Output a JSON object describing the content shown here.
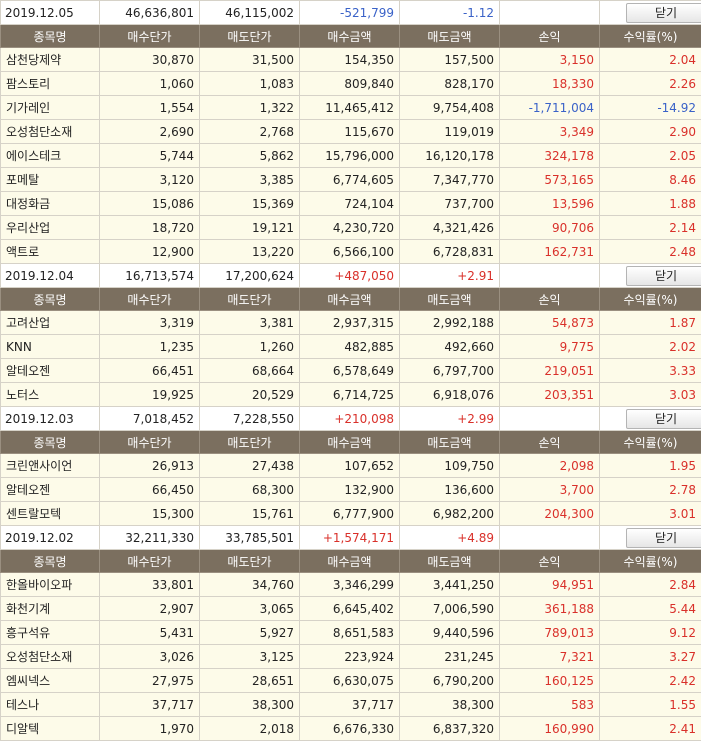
{
  "header_labels": [
    "종목명",
    "매수단가",
    "매도단가",
    "매수금액",
    "매도금액",
    "손익",
    "수익률(%)"
  ],
  "close_label": "닫기",
  "colors": {
    "header_bg": "#7b6f5f",
    "row_bg": "#fdfbe9",
    "profit": "#d9302a",
    "loss": "#3a62c8"
  },
  "groups": [
    {
      "date": "2019.12.05",
      "buy_total": "46,636,801",
      "sell_total": "46,115,002",
      "pnl": "-521,799",
      "rate": "-1.12",
      "sign": "neg",
      "rows": [
        {
          "name": "삼천당제약",
          "buy_price": "30,870",
          "sell_price": "31,500",
          "buy_amount": "154,350",
          "sell_amount": "157,500",
          "pnl": "3,150",
          "rate": "2.04",
          "sign": "pos"
        },
        {
          "name": "팜스토리",
          "buy_price": "1,060",
          "sell_price": "1,083",
          "buy_amount": "809,840",
          "sell_amount": "828,170",
          "pnl": "18,330",
          "rate": "2.26",
          "sign": "pos"
        },
        {
          "name": "기가레인",
          "buy_price": "1,554",
          "sell_price": "1,322",
          "buy_amount": "11,465,412",
          "sell_amount": "9,754,408",
          "pnl": "-1,711,004",
          "rate": "-14.92",
          "sign": "neg"
        },
        {
          "name": "오성첨단소재",
          "buy_price": "2,690",
          "sell_price": "2,768",
          "buy_amount": "115,670",
          "sell_amount": "119,019",
          "pnl": "3,349",
          "rate": "2.90",
          "sign": "pos"
        },
        {
          "name": "에이스테크",
          "buy_price": "5,744",
          "sell_price": "5,862",
          "buy_amount": "15,796,000",
          "sell_amount": "16,120,178",
          "pnl": "324,178",
          "rate": "2.05",
          "sign": "pos"
        },
        {
          "name": "포메탈",
          "buy_price": "3,120",
          "sell_price": "3,385",
          "buy_amount": "6,774,605",
          "sell_amount": "7,347,770",
          "pnl": "573,165",
          "rate": "8.46",
          "sign": "pos"
        },
        {
          "name": "대정화금",
          "buy_price": "15,086",
          "sell_price": "15,369",
          "buy_amount": "724,104",
          "sell_amount": "737,700",
          "pnl": "13,596",
          "rate": "1.88",
          "sign": "pos"
        },
        {
          "name": "우리산업",
          "buy_price": "18,720",
          "sell_price": "19,121",
          "buy_amount": "4,230,720",
          "sell_amount": "4,321,426",
          "pnl": "90,706",
          "rate": "2.14",
          "sign": "pos"
        },
        {
          "name": "액트로",
          "buy_price": "12,900",
          "sell_price": "13,220",
          "buy_amount": "6,566,100",
          "sell_amount": "6,728,831",
          "pnl": "162,731",
          "rate": "2.48",
          "sign": "pos"
        }
      ]
    },
    {
      "date": "2019.12.04",
      "buy_total": "16,713,574",
      "sell_total": "17,200,624",
      "pnl": "+487,050",
      "rate": "+2.91",
      "sign": "pos",
      "rows": [
        {
          "name": "고려산업",
          "buy_price": "3,319",
          "sell_price": "3,381",
          "buy_amount": "2,937,315",
          "sell_amount": "2,992,188",
          "pnl": "54,873",
          "rate": "1.87",
          "sign": "pos"
        },
        {
          "name": "KNN",
          "buy_price": "1,235",
          "sell_price": "1,260",
          "buy_amount": "482,885",
          "sell_amount": "492,660",
          "pnl": "9,775",
          "rate": "2.02",
          "sign": "pos"
        },
        {
          "name": "알테오젠",
          "buy_price": "66,451",
          "sell_price": "68,664",
          "buy_amount": "6,578,649",
          "sell_amount": "6,797,700",
          "pnl": "219,051",
          "rate": "3.33",
          "sign": "pos"
        },
        {
          "name": "노터스",
          "buy_price": "19,925",
          "sell_price": "20,529",
          "buy_amount": "6,714,725",
          "sell_amount": "6,918,076",
          "pnl": "203,351",
          "rate": "3.03",
          "sign": "pos"
        }
      ]
    },
    {
      "date": "2019.12.03",
      "buy_total": "7,018,452",
      "sell_total": "7,228,550",
      "pnl": "+210,098",
      "rate": "+2.99",
      "sign": "pos",
      "rows": [
        {
          "name": "크린앤사이언",
          "buy_price": "26,913",
          "sell_price": "27,438",
          "buy_amount": "107,652",
          "sell_amount": "109,750",
          "pnl": "2,098",
          "rate": "1.95",
          "sign": "pos"
        },
        {
          "name": "알테오젠",
          "buy_price": "66,450",
          "sell_price": "68,300",
          "buy_amount": "132,900",
          "sell_amount": "136,600",
          "pnl": "3,700",
          "rate": "2.78",
          "sign": "pos"
        },
        {
          "name": "센트랄모텍",
          "buy_price": "15,300",
          "sell_price": "15,761",
          "buy_amount": "6,777,900",
          "sell_amount": "6,982,200",
          "pnl": "204,300",
          "rate": "3.01",
          "sign": "pos"
        }
      ]
    },
    {
      "date": "2019.12.02",
      "buy_total": "32,211,330",
      "sell_total": "33,785,501",
      "pnl": "+1,574,171",
      "rate": "+4.89",
      "sign": "pos",
      "rows": [
        {
          "name": "한올바이오파",
          "buy_price": "33,801",
          "sell_price": "34,760",
          "buy_amount": "3,346,299",
          "sell_amount": "3,441,250",
          "pnl": "94,951",
          "rate": "2.84",
          "sign": "pos"
        },
        {
          "name": "화천기계",
          "buy_price": "2,907",
          "sell_price": "3,065",
          "buy_amount": "6,645,402",
          "sell_amount": "7,006,590",
          "pnl": "361,188",
          "rate": "5.44",
          "sign": "pos"
        },
        {
          "name": "흥구석유",
          "buy_price": "5,431",
          "sell_price": "5,927",
          "buy_amount": "8,651,583",
          "sell_amount": "9,440,596",
          "pnl": "789,013",
          "rate": "9.12",
          "sign": "pos"
        },
        {
          "name": "오성첨단소재",
          "buy_price": "3,026",
          "sell_price": "3,125",
          "buy_amount": "223,924",
          "sell_amount": "231,245",
          "pnl": "7,321",
          "rate": "3.27",
          "sign": "pos"
        },
        {
          "name": "엠씨넥스",
          "buy_price": "27,975",
          "sell_price": "28,651",
          "buy_amount": "6,630,075",
          "sell_amount": "6,790,200",
          "pnl": "160,125",
          "rate": "2.42",
          "sign": "pos"
        },
        {
          "name": "테스나",
          "buy_price": "37,717",
          "sell_price": "38,300",
          "buy_amount": "37,717",
          "sell_amount": "38,300",
          "pnl": "583",
          "rate": "1.55",
          "sign": "pos"
        },
        {
          "name": "디알텍",
          "buy_price": "1,970",
          "sell_price": "2,018",
          "buy_amount": "6,676,330",
          "sell_amount": "6,837,320",
          "pnl": "160,990",
          "rate": "2.41",
          "sign": "pos"
        }
      ]
    }
  ]
}
